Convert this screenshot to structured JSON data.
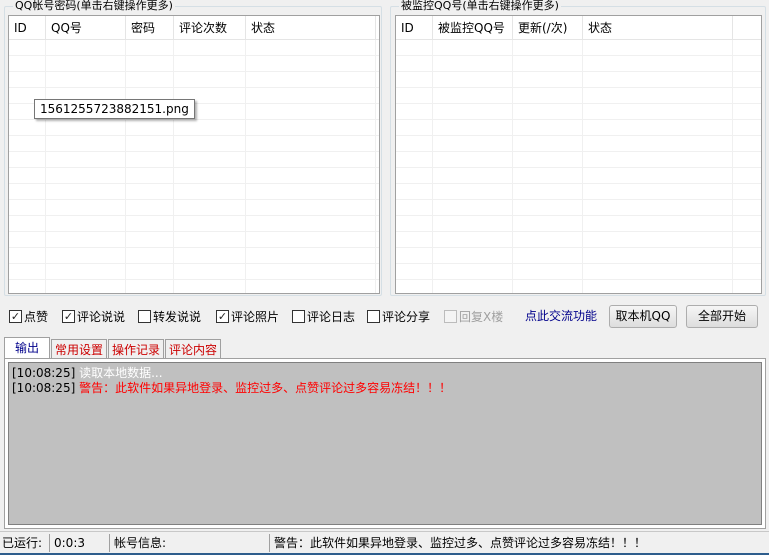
{
  "left_group": {
    "title": "QQ帐号密码(单击右键操作更多)",
    "columns": [
      "ID",
      "QQ号",
      "密码",
      "评论次数",
      "状态"
    ]
  },
  "right_group": {
    "title": "被监控QQ号(单击右键操作更多)",
    "columns": [
      "ID",
      "被监控QQ号",
      "更新(/次)",
      "状态"
    ]
  },
  "tooltip": "1561255723882151.png",
  "options": [
    {
      "label": "点赞",
      "checked": true,
      "check_mark": "✓"
    },
    {
      "label": "评论说说",
      "checked": true,
      "check_mark": "✓"
    },
    {
      "label": "转发说说",
      "checked": false,
      "check_mark": ""
    },
    {
      "label": "评论照片",
      "checked": true,
      "check_mark": "✓"
    },
    {
      "label": "评论日志",
      "checked": false,
      "check_mark": ""
    },
    {
      "label": "评论分享",
      "checked": false,
      "check_mark": ""
    },
    {
      "label": "回复X楼",
      "checked": false,
      "check_mark": "",
      "disabled": true
    }
  ],
  "link_label": "点此交流功能",
  "buttons": {
    "local_qq": "取本机QQ",
    "start_all": "全部开始"
  },
  "tabs": [
    "输出",
    "常用设置",
    "操作记录",
    "评论内容"
  ],
  "log": [
    {
      "time": "[10:08:25]",
      "message": "读取本地数据...",
      "color": "#ffffff"
    },
    {
      "time": "[10:08:25]",
      "message": "警告：此软件如果异地登录、监控过多、点赞评论过多容易冻结！！！",
      "color": "#ff0000"
    }
  ],
  "status": {
    "runtime_label": "已运行:",
    "runtime_value": "0:0:3",
    "account_label": "帐号信息:",
    "account_value": "",
    "warning": "警告：此软件如果异地登录、监控过多、点赞评论过多容易冻结！！！"
  },
  "colors": {
    "accent_blue": "#00008b",
    "tab_red": "#cc0000",
    "warning_red": "#ff0000",
    "log_bg": "#c0c0c0"
  }
}
